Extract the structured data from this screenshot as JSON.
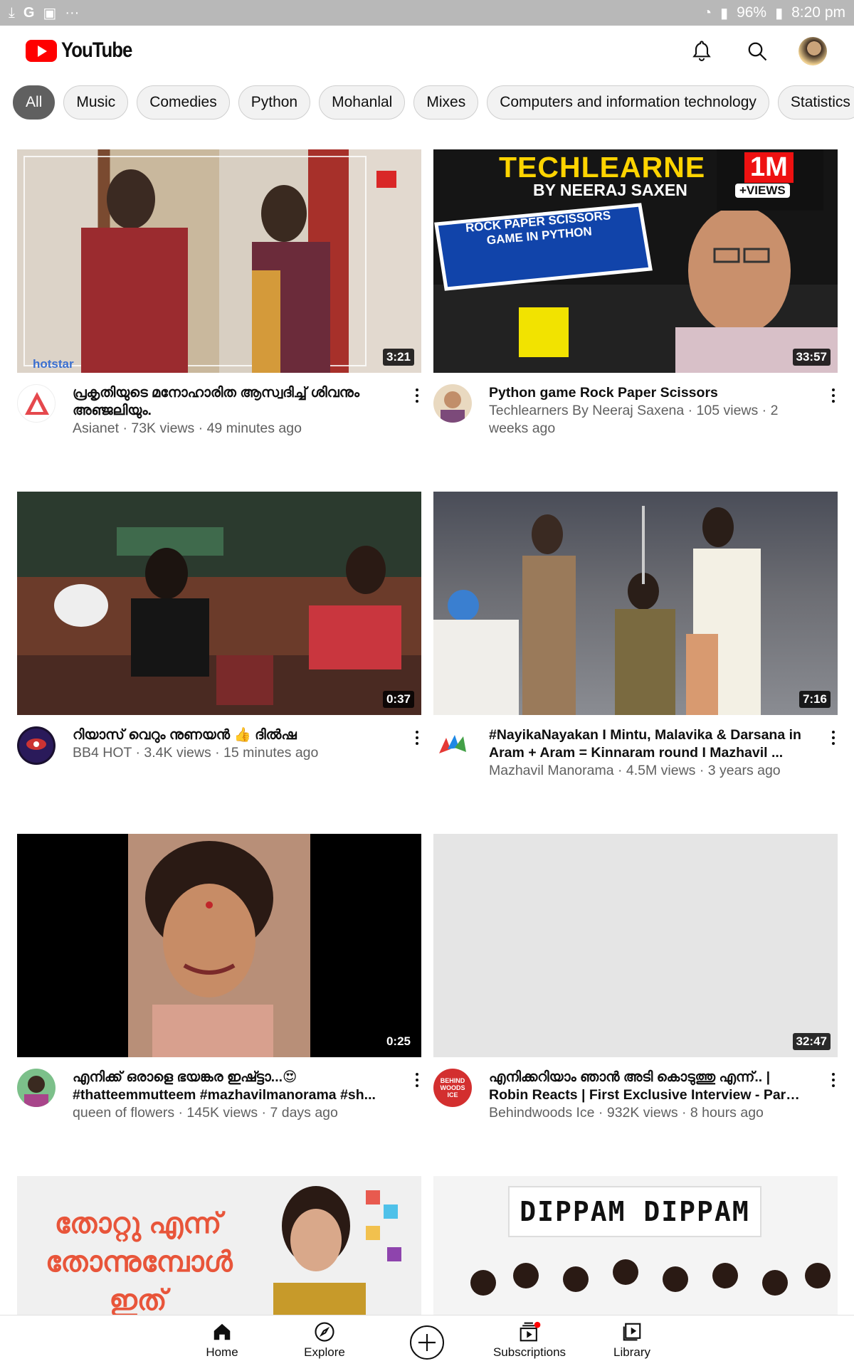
{
  "statusbar": {
    "battery": "96%",
    "time": "8:20 pm"
  },
  "header": {
    "logo_text": "YouTube"
  },
  "chips": [
    "All",
    "Music",
    "Comedies",
    "Python",
    "Mohanlal",
    "Mixes",
    "Computers and information technology",
    "Statistics"
  ],
  "videos": [
    {
      "title": "പ്രകൃതിയുടെ മനോഹാരിത ആസ്വദിച്ച് ശിവനും അഞ്ജലിയും.",
      "channel_line": "Asianet · 73K views · 49 minutes ago",
      "duration": "3:21",
      "thumb_badge": "hotstar"
    },
    {
      "title": "Python game Rock Paper Scissors",
      "channel_line": "Techlearners By Neeraj Saxena · 105 views · 2 weeks ago",
      "duration": "33:57",
      "thumb_text_1": "TECHLEARNE",
      "thumb_text_2": "BY NEERAJ SAXEN",
      "thumb_text_3": "ROCK PAPER SCISSORS GAME IN PYTHON",
      "thumb_badge_1": "1M",
      "thumb_badge_2": "+VIEWS"
    },
    {
      "title": "റിയാസ് വെറും നുണയൻ 👍 ദിൽഷ",
      "channel_line": "BB4 HOT · 3.4K views · 15 minutes ago",
      "duration": "0:37"
    },
    {
      "title": "#NayikaNayakan I Mintu, Malavika & Darsana in Aram + Aram = Kinnaram round I Mazhavil ...",
      "channel_line": "Mazhavil Manorama · 4.5M views · 3 years ago",
      "duration": "7:16"
    },
    {
      "title": "എനിക്ക് ഒരാളെ ഭയങ്കര ഇഷ്ട്ടാ...😍 #thatteemmutteem #mazhavilmanorama #sh...",
      "channel_line": "queen of flowers · 145K views · 7 days ago",
      "duration": "0:25"
    },
    {
      "title": "എനിക്കറിയാം ഞാൻ അടി കൊടുത്തു എന്ന്.. | Robin Reacts | First Exclusive Interview - Part ...",
      "channel_line": "Behindwoods Ice · 932K views · 8 hours ago",
      "duration": "32:47",
      "avatar_text": "BEHIND WOODS ICE"
    },
    {
      "title_art": "തോറ്റു എന്ന് തോന്നുമ്പോൾ ഇത് കേൾക്കുക"
    },
    {
      "title_art": "DIPPAM DIPPAM"
    }
  ],
  "bottomnav": {
    "home": "Home",
    "explore": "Explore",
    "subscriptions": "Subscriptions",
    "library": "Library"
  },
  "colors": {
    "brand": "#ff0000",
    "chip_active": "#606060",
    "chip_bg": "#f2f2f2",
    "secondary_text": "#606060"
  }
}
